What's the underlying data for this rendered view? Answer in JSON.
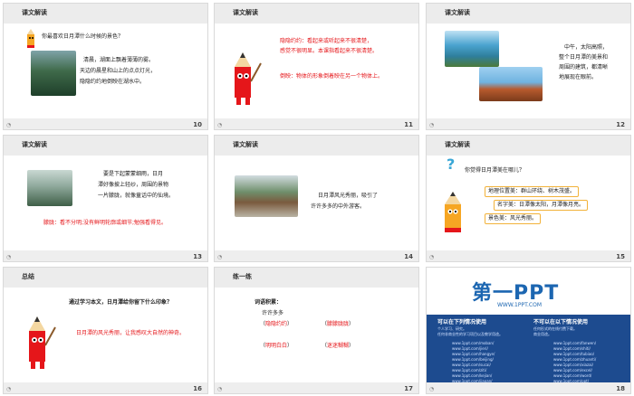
{
  "slides": [
    {
      "num": "10",
      "title": "课文解读",
      "question": "你最喜欢日月潭什么时候的景色？",
      "lines": [
        "清晨，湖面上飘着薄薄的雾。",
        "天边的晨星和山上的点点灯光，",
        "隐隐约约地倒映在湖水中。"
      ]
    },
    {
      "num": "11",
      "title": "课文解读",
      "lines": [
        "隐隐约约：看起来或听起来不很清楚，",
        "感觉不很明显。本课指看起来不很清楚。"
      ],
      "def2": "倒映：物体的形象倒着映在另一个物体上。"
    },
    {
      "num": "12",
      "title": "课文解读",
      "lines": [
        "中午，太阳高照，",
        "整个日月潭的美景和",
        "周围的建筑，都清晰",
        "地展现在眼前。"
      ]
    },
    {
      "num": "13",
      "title": "课文解读",
      "lines": [
        "要是下起蒙蒙细雨，日月",
        "潭好像披上轻纱，周围的景物",
        "一片朦胧，就像童话中的仙境。"
      ],
      "def": "朦胧：看不分明;没有鲜明轮廓或细节;勉强看得见。"
    },
    {
      "num": "14",
      "title": "课文解读",
      "lines": [
        "日月潭风光秀丽，吸引了",
        "许许多多的中外游客。"
      ]
    },
    {
      "num": "15",
      "title": "课文解读",
      "question": "你觉得日月潭美在哪儿？",
      "boxes": [
        "地理位置美：群山环绕、树木茂盛。",
        "名字美：日潭像太阳，月潭像月亮。",
        "景色美：风光秀丽。"
      ]
    },
    {
      "num": "16",
      "title": "总结",
      "question": "通过学习本文，日月潭给你留下什么印象？",
      "answer": "日月潭的风光秀丽，让我感叹大自然的神奇。"
    },
    {
      "num": "17",
      "title": "练一练",
      "heading": "词语积累：",
      "sub": "许许多多",
      "words": [
        "隐隐约约",
        "朦朦胧胧",
        "明明白白",
        "迷迷糊糊"
      ],
      "paren_open": "（",
      "paren_close": "）"
    },
    {
      "num": "18",
      "logo_text": "第一PPT",
      "logo_url": "WWW.1PPT.COM",
      "can_title": "可以在下列情况使用",
      "cannot_title": "不可以在以下情况使用",
      "can_lines": [
        "个人学习、研究。",
        "任何非商业性的学习项目以及教学用途。"
      ],
      "cannot_lines": [
        "任何形式的在线付费下载。",
        "商业用途。"
      ],
      "links_left": [
        "www.1ppt.com/moban/",
        "www.1ppt.com/jieri/",
        "www.1ppt.com/hangye/",
        "www.1ppt.com/beijing/",
        "www.1ppt.com/sucai/",
        "www.1ppt.com/ziti/",
        "www.1ppt.com/kejian/",
        "www.1ppt.com/jiaoan/"
      ],
      "links_right": [
        "www.1ppt.com/fanwen/",
        "www.1ppt.com/shiti/",
        "www.1ppt.com/tubiao/",
        "www.1ppt.com/zhuanti/",
        "www.1ppt.com/xiazai/",
        "www.1ppt.com/excel/",
        "www.1ppt.com/word/",
        "www.1ppt.com/ppt/"
      ]
    }
  ],
  "colors": {
    "red": "#e5161a",
    "header": "#ececec",
    "accent": "#1c66b1",
    "panel": "#1d4b8f"
  }
}
